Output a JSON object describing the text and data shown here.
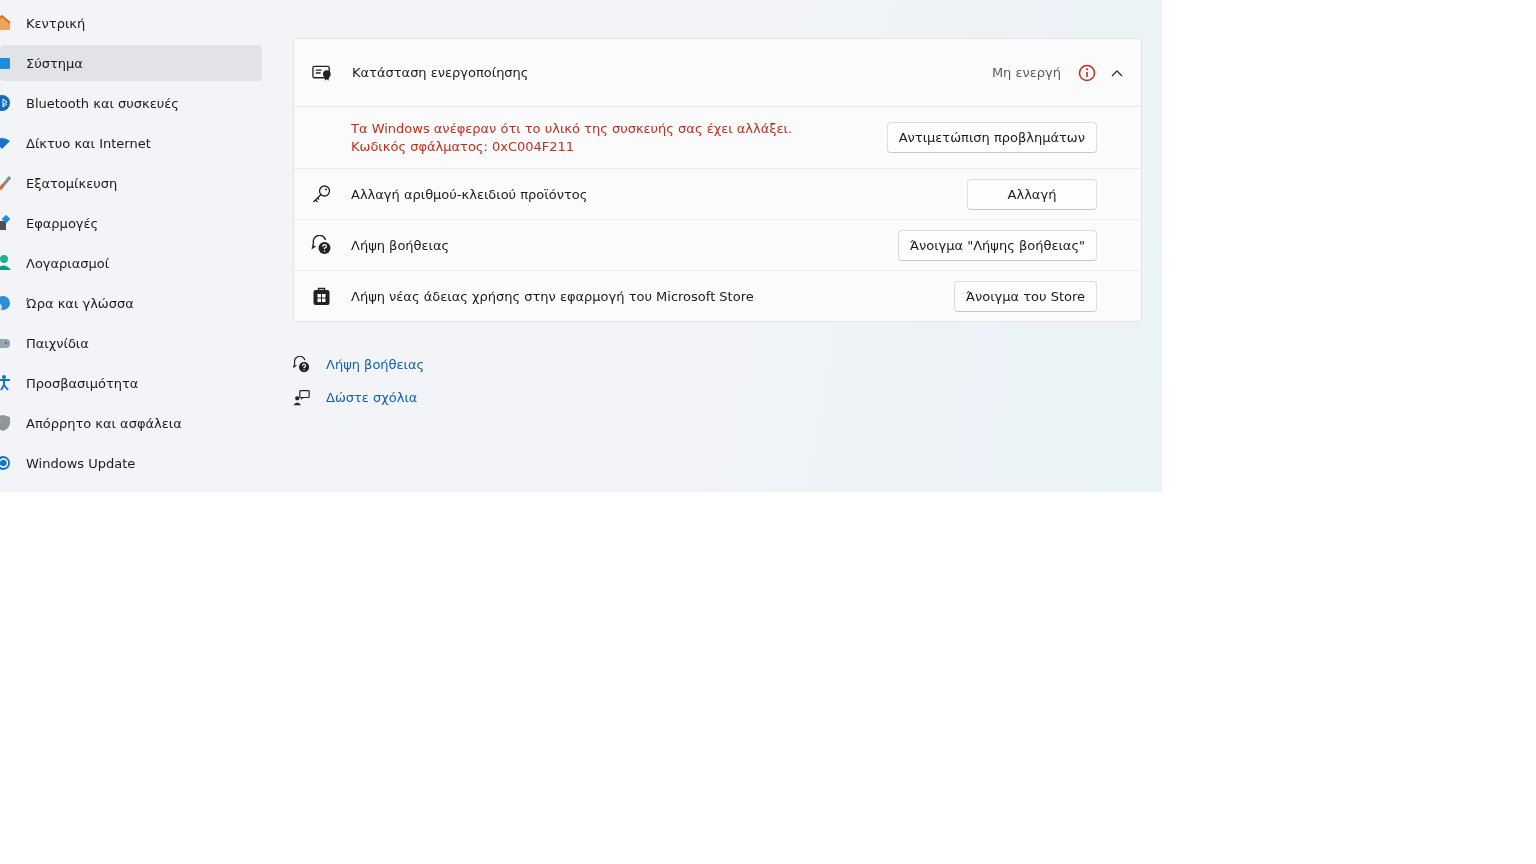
{
  "sidebar": {
    "items": [
      {
        "label": "Κεντρική",
        "selected": false
      },
      {
        "label": "Σύστημα",
        "selected": true
      },
      {
        "label": "Bluetooth και συσκευές",
        "selected": false
      },
      {
        "label": "Δίκτυο και Internet",
        "selected": false
      },
      {
        "label": "Εξατομίκευση",
        "selected": false
      },
      {
        "label": "Εφαρμογές",
        "selected": false
      },
      {
        "label": "Λογαριασμοί",
        "selected": false
      },
      {
        "label": "Ώρα και γλώσσα",
        "selected": false
      },
      {
        "label": "Παιχνίδια",
        "selected": false
      },
      {
        "label": "Προσβασιμότητα",
        "selected": false
      },
      {
        "label": "Απόρρητο και ασφάλεια",
        "selected": false
      },
      {
        "label": "Windows Update",
        "selected": false
      }
    ]
  },
  "activation": {
    "title": "Κατάσταση ενεργοποίησης",
    "status": "Μη ενεργή",
    "expanded": true,
    "error": {
      "message": "Τα Windows ανέφεραν ότι το υλικό της συσκευής σας έχει αλλάξει. Κωδικός σφάλματος: 0xC004F211",
      "button": "Αντιμετώπιση προβλημάτων"
    },
    "rows": [
      {
        "kind": "key",
        "label": "Αλλαγή αριθμού-κλειδιού προϊόντος",
        "button": "Αλλαγή"
      },
      {
        "kind": "help",
        "label": "Λήψη βοήθειας",
        "button": "Άνοιγμα \"Λήψης βοήθειας\""
      },
      {
        "kind": "store",
        "label": "Λήψη νέας άδειας χρήσης στην εφαρμογή του Microsoft Store",
        "button": "Άνοιγμα του Store"
      }
    ]
  },
  "links": [
    {
      "kind": "help",
      "label": "Λήψη βοήθειας"
    },
    {
      "kind": "feedback",
      "label": "Δώστε σχόλια"
    }
  ]
}
